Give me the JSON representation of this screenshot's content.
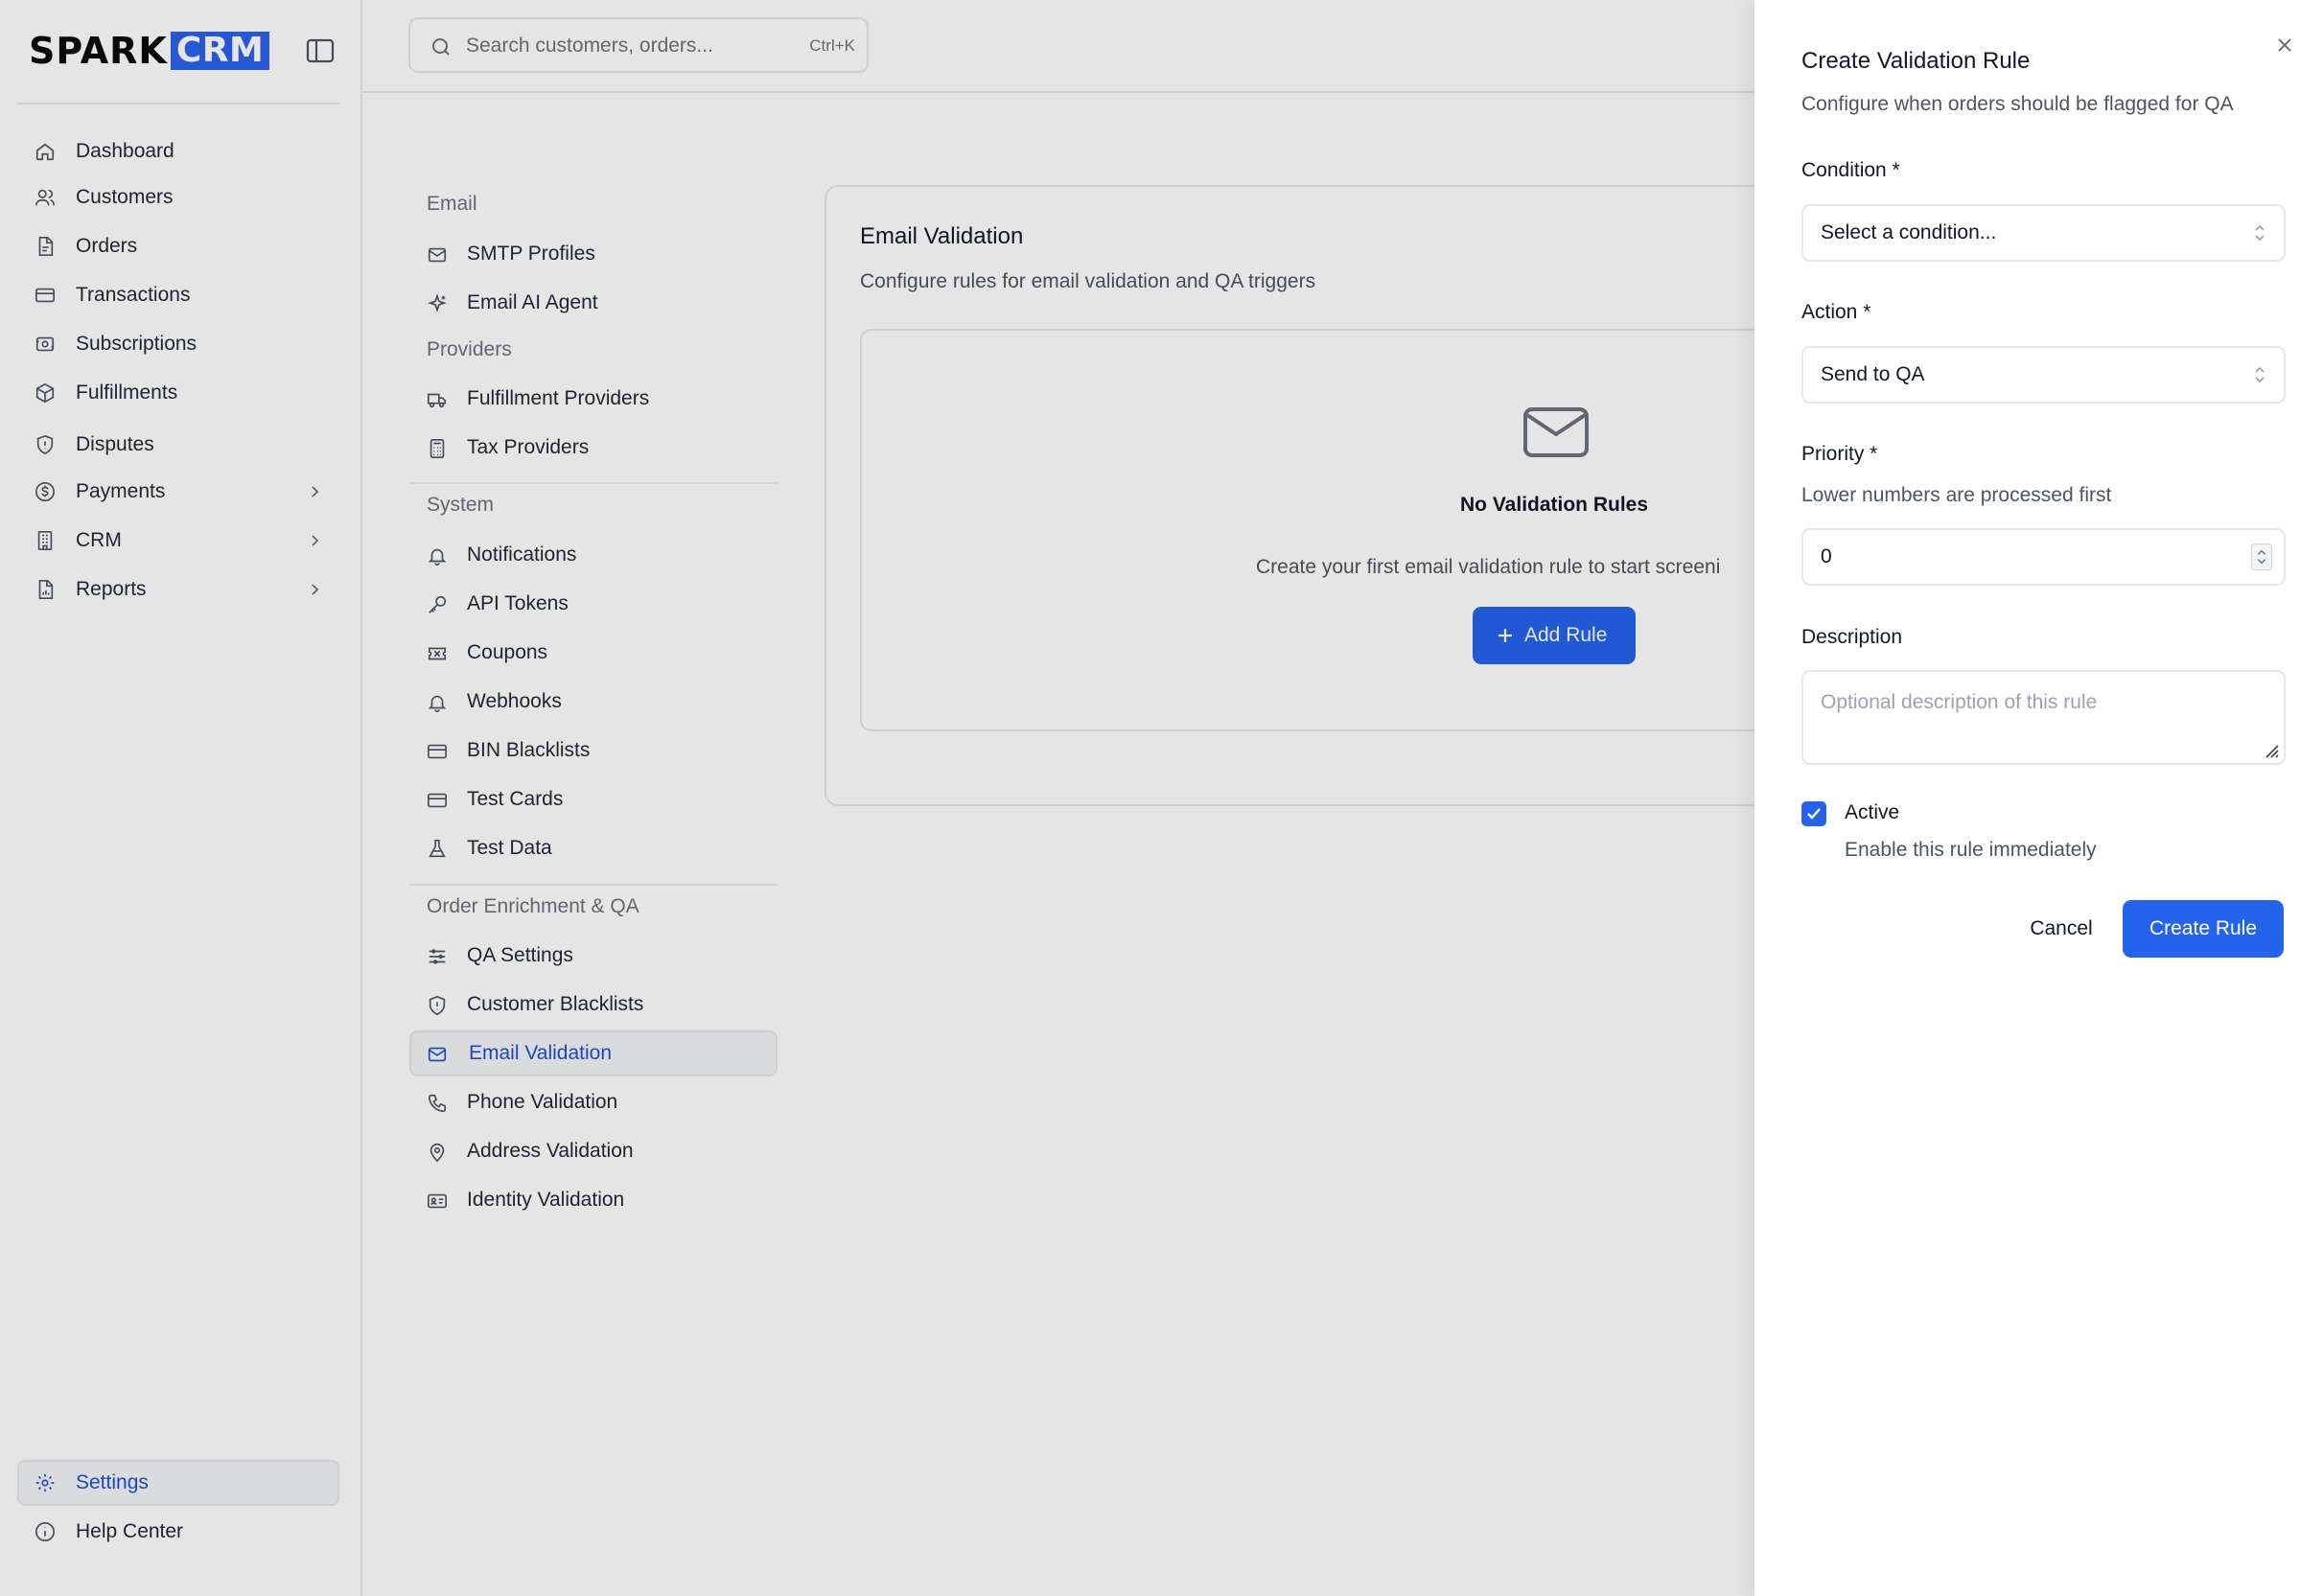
{
  "brand": {
    "spark": "SPARK",
    "crm": "CRM",
    "accent_color": "#2b63ec"
  },
  "sidebar": {
    "items": [
      {
        "label": "Dashboard",
        "icon": "home-icon"
      },
      {
        "label": "Customers",
        "icon": "users-icon"
      },
      {
        "label": "Orders",
        "icon": "file-icon"
      },
      {
        "label": "Transactions",
        "icon": "credit-card-icon"
      },
      {
        "label": "Subscriptions",
        "icon": "repeat-icon"
      },
      {
        "label": "Fulfillments",
        "icon": "package-icon"
      },
      {
        "label": "Disputes",
        "icon": "shield-icon"
      },
      {
        "label": "Payments",
        "icon": "dollar-icon"
      },
      {
        "label": "CRM",
        "icon": "building-icon"
      },
      {
        "label": "Reports",
        "icon": "chart-file-icon"
      }
    ],
    "bottom": [
      {
        "label": "Settings",
        "icon": "gear-icon"
      },
      {
        "label": "Help Center",
        "icon": "info-icon"
      }
    ]
  },
  "search": {
    "placeholder": "Search customers, orders...",
    "shortcut": "Ctrl+K"
  },
  "settings_nav": {
    "sections": [
      {
        "heading": "Email",
        "items": [
          {
            "label": "SMTP Profiles"
          },
          {
            "label": "Email AI Agent"
          }
        ]
      },
      {
        "heading": "Providers",
        "items": [
          {
            "label": "Fulfillment Providers"
          },
          {
            "label": "Tax Providers"
          }
        ]
      },
      {
        "heading": "System",
        "items": [
          {
            "label": "Notifications"
          },
          {
            "label": "API Tokens"
          },
          {
            "label": "Coupons"
          },
          {
            "label": "Webhooks"
          },
          {
            "label": "BIN Blacklists"
          },
          {
            "label": "Test Cards"
          },
          {
            "label": "Test Data"
          }
        ]
      },
      {
        "heading": "Order Enrichment & QA",
        "items": [
          {
            "label": "QA Settings"
          },
          {
            "label": "Customer Blacklists"
          },
          {
            "label": "Email Validation"
          },
          {
            "label": "Phone Validation"
          },
          {
            "label": "Address Validation"
          },
          {
            "label": "Identity Validation"
          }
        ]
      }
    ]
  },
  "main": {
    "title": "Email Validation",
    "subtitle": "Configure rules for email validation and QA triggers",
    "empty_title": "No Validation Rules",
    "empty_desc": "Create your first email validation rule to start screeni",
    "add_rule_label": "Add Rule"
  },
  "drawer": {
    "title": "Create Validation Rule",
    "subtitle": "Configure when orders should be flagged for QA",
    "condition_label": "Condition *",
    "condition_value": "Select a condition...",
    "action_label": "Action *",
    "action_value": "Send to QA",
    "priority_label": "Priority *",
    "priority_help": "Lower numbers are processed first",
    "priority_value": "0",
    "description_label": "Description",
    "description_placeholder": "Optional description of this rule",
    "active_label": "Active",
    "active_help": "Enable this rule immediately",
    "active_checked": true,
    "cancel_label": "Cancel",
    "create_label": "Create Rule",
    "primary_color": "#2563eb"
  }
}
